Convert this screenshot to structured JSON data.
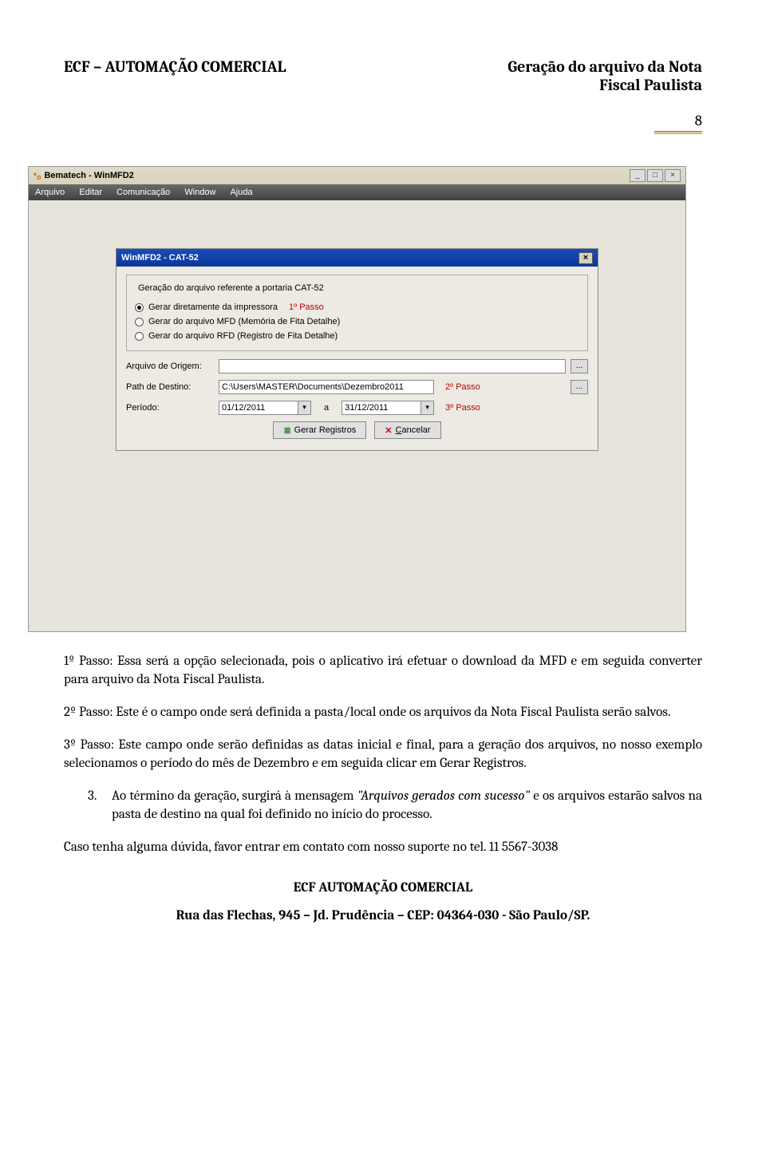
{
  "header": {
    "left": "ECF – AUTOMAÇÃO COMERCIAL",
    "right_line1": "Geração do arquivo da Nota",
    "right_line2": "Fiscal Paulista"
  },
  "page_number": "8",
  "main_window": {
    "brand_prefix": "•",
    "brand_small": "o",
    "title_brand": "Bematech",
    "title_app": " - WinMFD2",
    "menus": [
      "Arquivo",
      "Editar",
      "Comunicação",
      "Window",
      "Ajuda"
    ],
    "min_btn": "_",
    "restore_btn": "□",
    "close_btn": "×"
  },
  "dialog": {
    "title": "WinMFD2 - CAT-52",
    "close": "×",
    "legend": "Geração do arquivo referente a portaria CAT-52",
    "radio1": "Gerar diretamente da impressora",
    "radio2": "Gerar do arquivo MFD (Memória de Fita Detalhe)",
    "radio3": "Gerar do arquivo RFD (Registro de Fita Detalhe)",
    "passo1": "1º Passo",
    "label_origem": "Arquivo de Origem:",
    "value_origem": "",
    "label_path": "Path de Destino:",
    "value_path": "C:\\Users\\MASTER\\Documents\\Dezembro2011",
    "passo2": "2º Passo",
    "label_periodo": "Período:",
    "date_from": "01/12/2011",
    "date_sep": "a",
    "date_to": "31/12/2011",
    "passo3": "3º Passo",
    "browse": "...",
    "btn_gerar": "Gerar Registros",
    "btn_cancel": "Cancelar",
    "underline_c": "C",
    "dd": "▾"
  },
  "body": {
    "p1": "1º Passo: Essa será a opção selecionada, pois o aplicativo irá efetuar o download da MFD e em seguida converter para arquivo da Nota Fiscal Paulista.",
    "p2": "2º Passo: Este é o campo onde será definida a pasta/local onde os arquivos da Nota Fiscal Paulista serão salvos.",
    "p3": "3º Passo: Este campo onde serão definidas as datas inicial e final, para a geração dos arquivos, no nosso exemplo selecionamos o período do mês de Dezembro e em seguida clicar em Gerar Registros.",
    "item3_num": "3.",
    "item3_a": "Ao término da geração, surgirá à mensagem ",
    "item3_b": "\"Arquivos gerados com sucesso\"",
    "item3_c": " e os arquivos estarão salvos na pasta de destino na qual foi definido no início do processo.",
    "p4": "Caso tenha alguma dúvida, favor entrar em contato com nosso suporte no tel. 11 5567-3038",
    "center": "ECF AUTOMAÇÃO COMERCIAL"
  },
  "footer": "Rua das Flechas, 945 – Jd. Prudência – CEP: 04364-030 - São Paulo/SP."
}
